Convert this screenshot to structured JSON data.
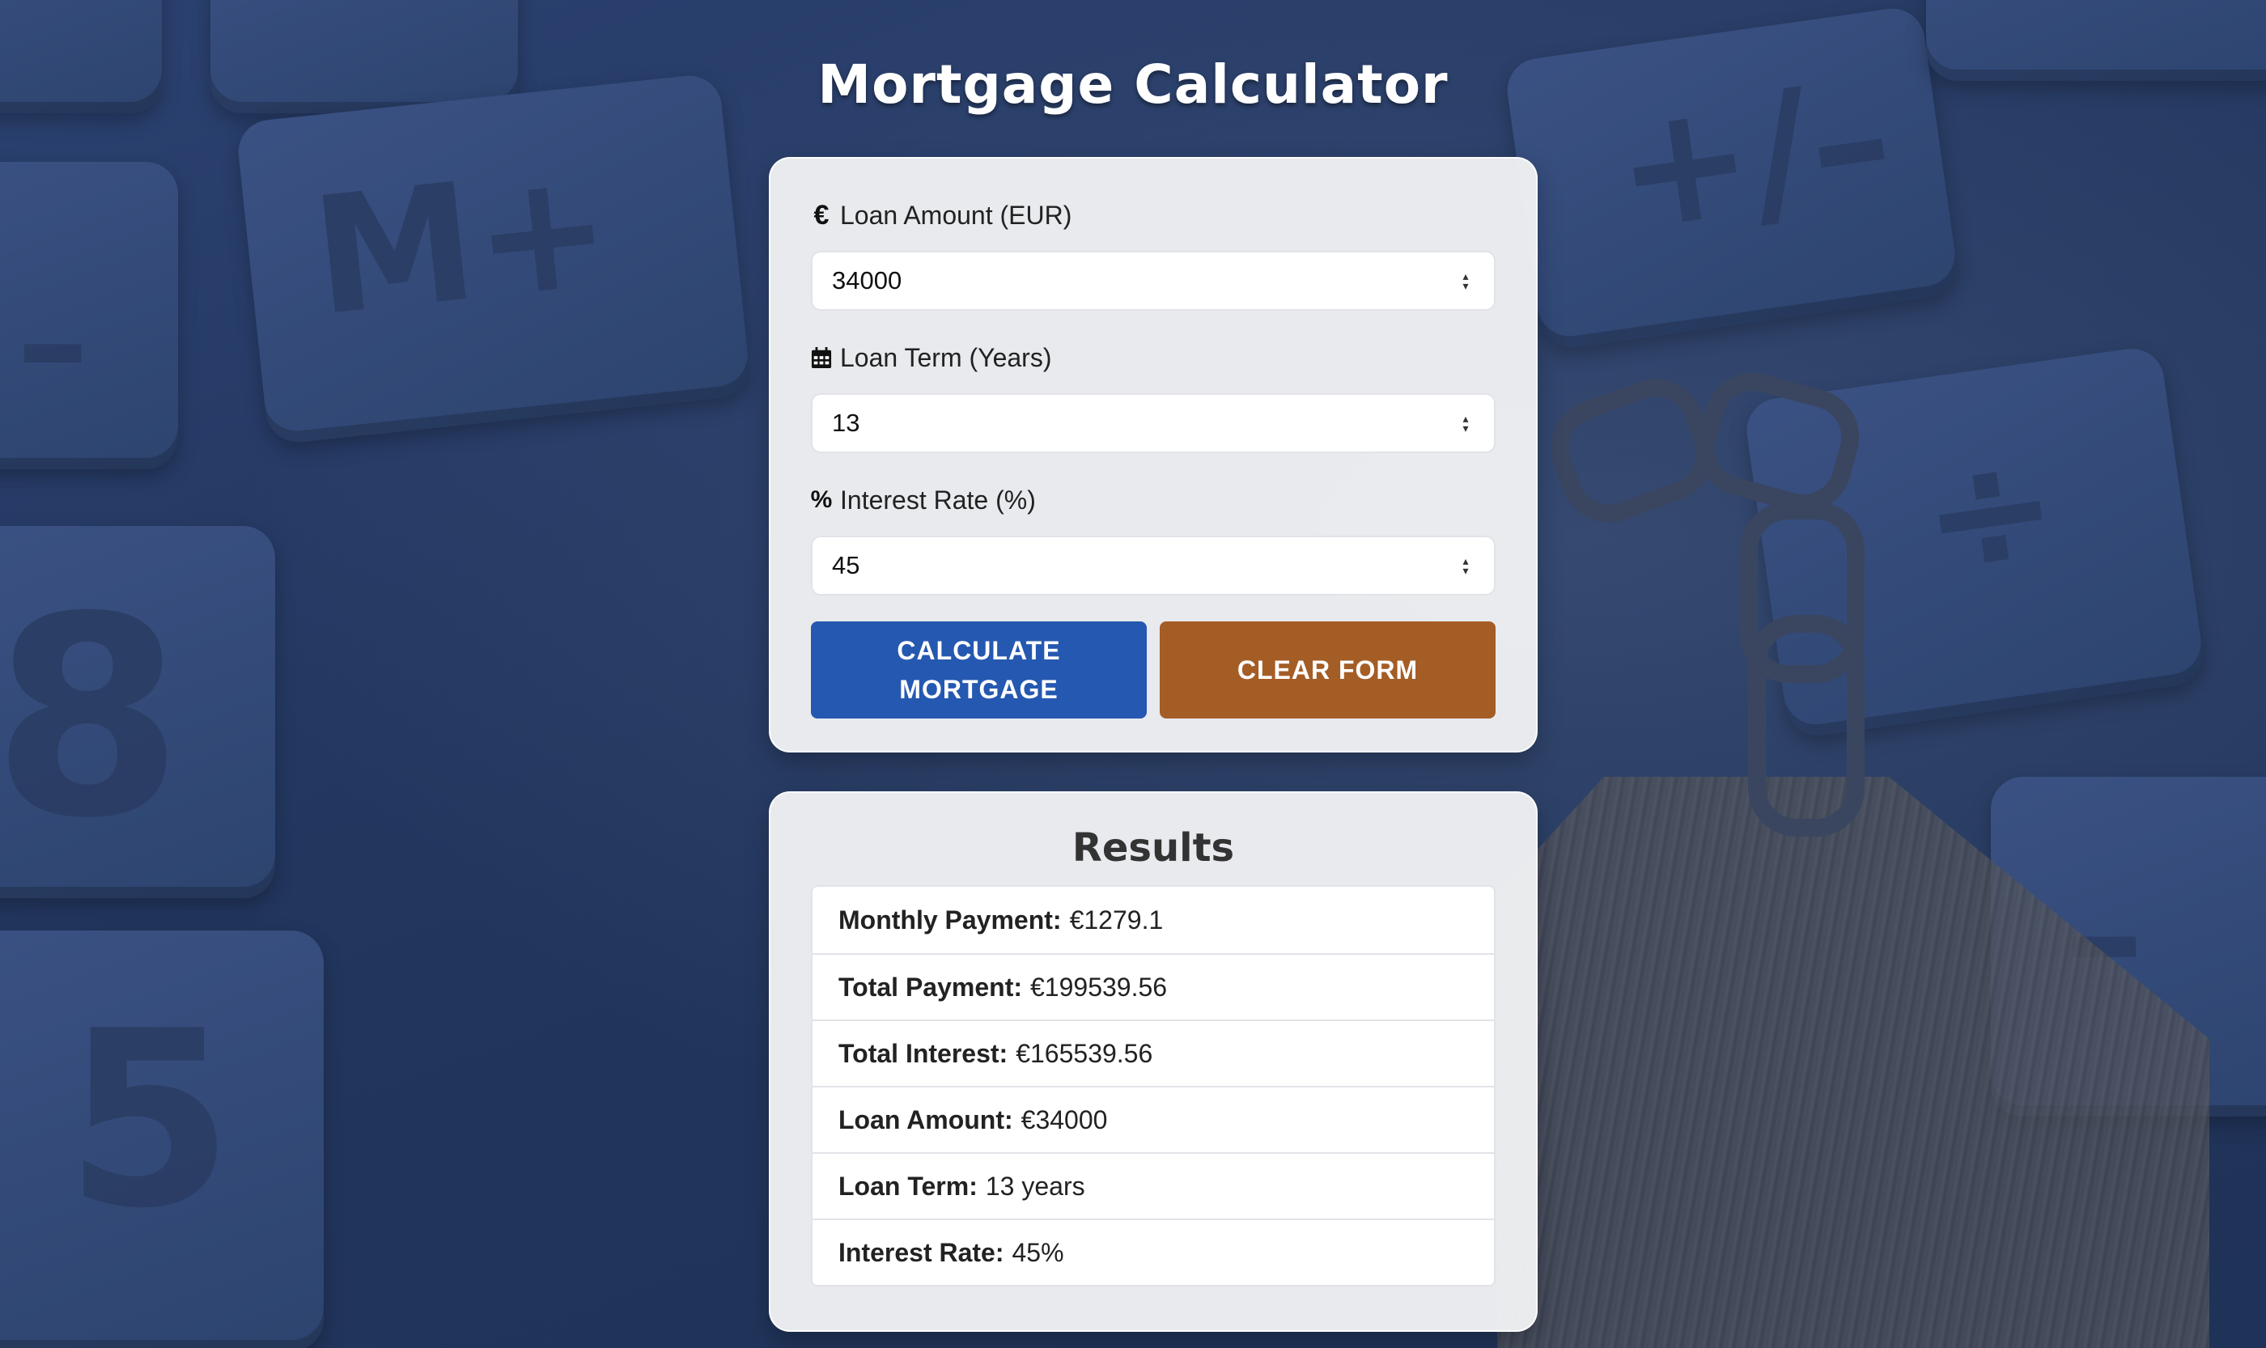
{
  "page": {
    "title": "Mortgage Calculator"
  },
  "form": {
    "fields": [
      {
        "icon": "euro-icon",
        "glyph": "€",
        "label": "Loan Amount (EUR)",
        "value": "34000"
      },
      {
        "icon": "calendar-icon",
        "glyph": "",
        "label": "Loan Term (Years)",
        "value": "13"
      },
      {
        "icon": "percent-icon",
        "glyph": "%",
        "label": "Interest Rate (%)",
        "value": "45"
      }
    ],
    "calculate_label": "CALCULATE MORTGAGE",
    "clear_label": "CLEAR FORM",
    "colors": {
      "calculate": "#2558b0",
      "clear": "#a55d26"
    }
  },
  "results": {
    "title": "Results",
    "items": [
      {
        "label": "Monthly Payment:",
        "value": "€1279.1"
      },
      {
        "label": "Total Payment:",
        "value": "€199539.56"
      },
      {
        "label": "Total Interest:",
        "value": "€165539.56"
      },
      {
        "label": "Loan Amount:",
        "value": "€34000"
      },
      {
        "label": "Loan Term:",
        "value": "13 years"
      },
      {
        "label": "Interest Rate:",
        "value": "45%"
      }
    ]
  }
}
